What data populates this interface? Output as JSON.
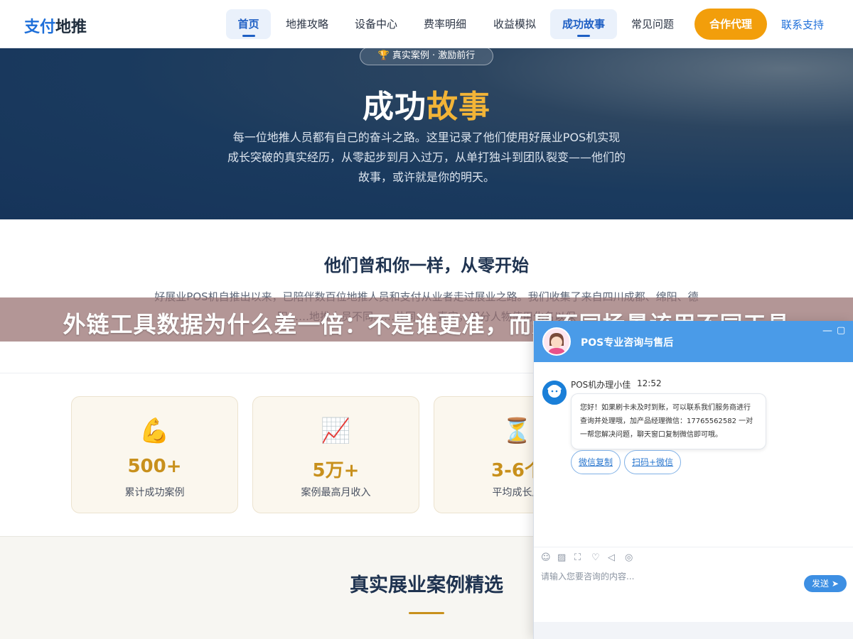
{
  "nav": {
    "logo_part1": "支付",
    "logo_part2": "地推",
    "items": [
      {
        "label": "首页"
      },
      {
        "label": "地推攻略"
      },
      {
        "label": "设备中心"
      },
      {
        "label": "费率明细"
      },
      {
        "label": "收益模拟"
      },
      {
        "label": "成功故事"
      },
      {
        "label": "常见问题"
      }
    ],
    "cta": "合作代理",
    "support": "联系支持"
  },
  "hero": {
    "badge": "真实案例 · 激励前行",
    "title_part1": "成功",
    "title_part2": "故事",
    "description": "每一位地推人员都有自己的奋斗之路。这里记录了他们使用好展业POS机实现成长突破的真实经历，从零起步到月入过万，从单打独斗到团队裂变——他们的故事，或许就是你的明天。"
  },
  "intro": {
    "title": "他们曾和你一样，从零开始",
    "description": "好展业POS机自推出以来，已陪伴数百位地推人员和支付从业者走过展业之路。我们收集了来自四川成都、绵阳、德阳……地推人员不同……共同……真实，部分人物使用化名以保"
  },
  "stats": [
    {
      "icon": "flexed-biceps",
      "value": "500+",
      "label": "累计成功案例"
    },
    {
      "icon": "chart-increasing",
      "value": "5万+",
      "label": "案例最高月收入"
    },
    {
      "icon": "hourglass",
      "value": "3-6个",
      "label": "平均成长周"
    }
  ],
  "cases": {
    "title": "真实展业案例精选"
  },
  "banner": {
    "text": "外链工具数据为什么差一倍：不是谁更准，而是不同场景该用不同工具"
  },
  "chat": {
    "title": "POS专业咨询与售后",
    "agent_name": "POS机办理小佳",
    "time": "12:52",
    "message": "您好！如果刷卡未及时到账，可以联系我们服务商进行查询并处理哦，加产品经理微信：17765562582 一对一帮您解决问题，聊天窗口复制微信即可哦。",
    "quick_replies": [
      "微信复制",
      "扫码+微信"
    ],
    "input_placeholder": "请输入您要咨询的内容...",
    "send": "发送"
  },
  "colors": {
    "brand_blue": "#1e6fd9",
    "accent_orange": "#f29e0b",
    "gold": "#c8901c",
    "hero_navy": "#1a3a5e",
    "chat_header": "#4a9be8"
  }
}
